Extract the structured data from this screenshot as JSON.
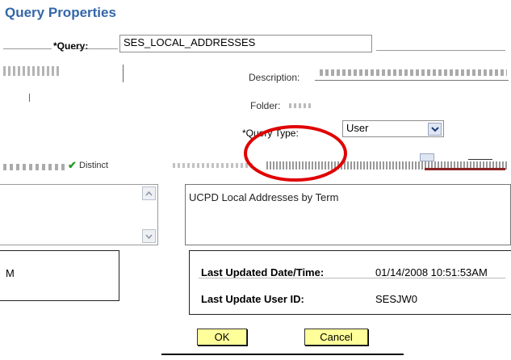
{
  "title": "Query Properties",
  "form": {
    "query_label": "*Query:",
    "query_value": "SES_LOCAL_ADDRESSES",
    "description_label": "Description:",
    "folder_label": "Folder:",
    "query_type_label": "*Query Type:",
    "query_type_value": "User",
    "distinct_label": "Distinct",
    "long_description": "UCPD Local Addresses by Term"
  },
  "audit": {
    "owner_fragment": "M",
    "last_updated_label": "Last Updated Date/Time:",
    "last_updated_value": "01/14/2008 10:51:53AM",
    "last_user_label": "Last Update User ID:",
    "last_user_value": "SESJW0"
  },
  "buttons": {
    "ok": "OK",
    "cancel": "Cancel"
  },
  "colors": {
    "title": "#3366aa",
    "button_bg": "#ffff99",
    "highlight_circle": "#e00000"
  }
}
